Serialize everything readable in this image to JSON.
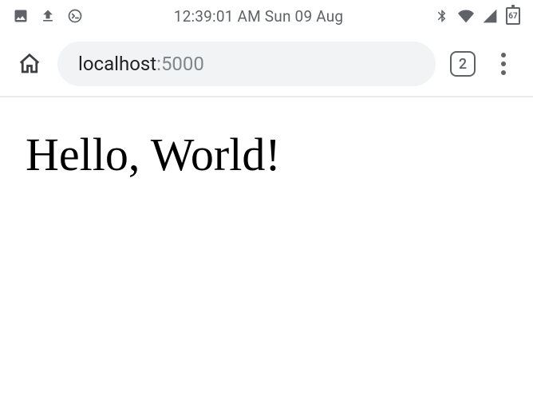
{
  "status": {
    "time_date": "12:39:01 AM Sun 09 Aug",
    "battery": "67"
  },
  "browser": {
    "url_host": "localhost",
    "url_port": ":5000",
    "tab_count": "2"
  },
  "page": {
    "heading": "Hello, World!"
  }
}
